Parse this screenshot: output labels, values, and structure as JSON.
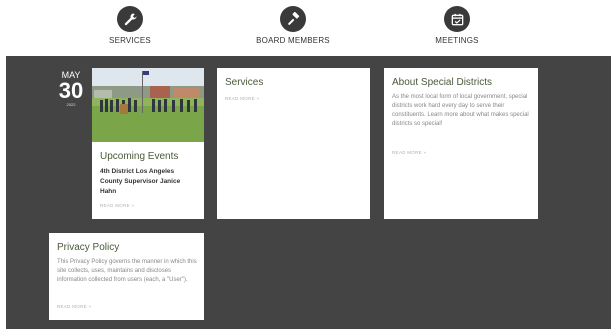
{
  "nav": {
    "items": [
      {
        "label": "SERVICES",
        "icon": "wrench-icon"
      },
      {
        "label": "BOARD MEMBERS",
        "icon": "gavel-icon"
      },
      {
        "label": "MEETINGS",
        "icon": "calendar-icon"
      }
    ]
  },
  "date": {
    "month": "MAY",
    "day": "30",
    "year": "2022"
  },
  "cards": {
    "events": {
      "title": "Upcoming Events",
      "text": "4th District Los Angeles County Supervisor Janice Hahn",
      "read_more": "READ MORE »"
    },
    "services": {
      "title": "Services",
      "read_more": "READ MORE »"
    },
    "special_districts": {
      "title": "About Special Districts",
      "text": "As the most local form of local government, special districts work hard every day to serve their constituents. Learn more about what makes special districts so special!",
      "read_more": "READ MORE »"
    },
    "privacy": {
      "title": "Privacy Policy",
      "text": "This Privacy Policy governs the manner in which this site collects, uses, maintains and discloses information collected from users (each, a \"User\").",
      "read_more": "READ MORE »"
    }
  },
  "colors": {
    "band": "#444444",
    "icon_circle": "#3a3a3a",
    "title": "#4a5a3a"
  }
}
